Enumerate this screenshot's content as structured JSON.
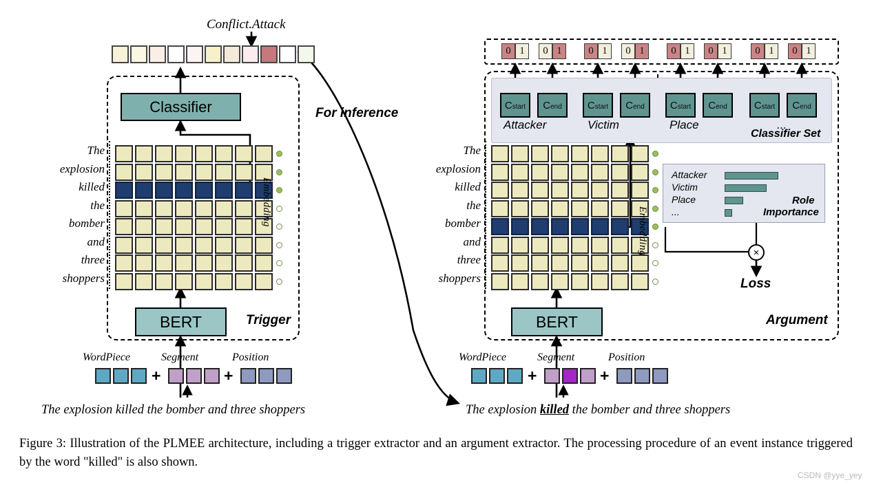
{
  "figure": {
    "caption": "Figure 3: Illustration of the PLMEE architecture, including a trigger extractor and an argument extractor. The processing procedure of an event instance triggered by the word \"killed\" is also shown.",
    "watermark": "CSDN @yye_yey"
  },
  "trigger_extractor": {
    "panel_label": "Trigger",
    "event_type_label": "Conflict.Attack",
    "classifier_label": "Classifier",
    "bert_label": "BERT",
    "embedding_label": "Embedding",
    "output_cells": [
      "#F7F2D8",
      "#FAF8E2",
      "#FAEFE7",
      "#FFFFFF",
      "#FBF4F3",
      "#F8F0C9",
      "#F4EADB",
      "#FBEAEE",
      "#C4797C",
      "#FFFFFF",
      "#F2F8EA"
    ],
    "highlighted_output_index": 8,
    "words": [
      "The",
      "explosion",
      "killed",
      "the",
      "bomber",
      "and",
      "three",
      "shoppers"
    ],
    "highlighted_word_index": 2,
    "grid_columns": 8,
    "embedding_inputs": {
      "wordpiece_label": "WordPiece",
      "segment_label": "Segment",
      "position_label": "Position",
      "wordpiece_count": 3,
      "segment_count": 3,
      "position_count": 3,
      "segment_highlight_index": -1,
      "plus_symbol": "+"
    },
    "sentence": "The explosion killed the bomber and three shoppers"
  },
  "inference_arrow_label": "For inference",
  "argument_extractor": {
    "panel_label": "Argument",
    "classifier_set_label": "Classifier Set",
    "bert_label": "BERT",
    "embedding_label": "Embedding",
    "roles": [
      {
        "name": "Attacker",
        "start_label": "C",
        "start_sub": "start",
        "end_label": "C",
        "end_sub": "end"
      },
      {
        "name": "Victim",
        "start_label": "C",
        "start_sub": "start",
        "end_label": "C",
        "end_sub": "end"
      },
      {
        "name": "Place",
        "start_label": "C",
        "start_sub": "start",
        "end_label": "C",
        "end_sub": "end"
      },
      {
        "name": "...",
        "start_label": "C",
        "start_sub": "start",
        "end_label": "C",
        "end_sub": "end"
      }
    ],
    "binary_outputs": [
      {
        "zero": "0",
        "one": "1",
        "zero_active": true,
        "one_active": false
      },
      {
        "zero": "0",
        "one": "1",
        "zero_active": false,
        "one_active": true
      },
      {
        "zero": "0",
        "one": "1",
        "zero_active": true,
        "one_active": false
      },
      {
        "zero": "0",
        "one": "1",
        "zero_active": false,
        "one_active": true
      },
      {
        "zero": "0",
        "one": "1",
        "zero_active": true,
        "one_active": false
      },
      {
        "zero": "0",
        "one": "1",
        "zero_active": true,
        "one_active": false
      },
      {
        "zero": "0",
        "one": "1",
        "zero_active": true,
        "one_active": false
      },
      {
        "zero": "0",
        "one": "1",
        "zero_active": true,
        "one_active": false
      }
    ],
    "words": [
      "The",
      "explosion",
      "killed",
      "the",
      "bomber",
      "and",
      "three",
      "shoppers"
    ],
    "highlighted_word_index": 4,
    "grid_columns": 8,
    "role_importance": {
      "title_line1": "Role",
      "title_line2": "Importance",
      "items": [
        {
          "label": "Attacker",
          "value": 100
        },
        {
          "label": "Victim",
          "value": 78
        },
        {
          "label": "Place",
          "value": 34
        },
        {
          "label": "...",
          "value": 14
        }
      ]
    },
    "multiply_symbol": "×",
    "loss_label": "Loss",
    "embedding_inputs": {
      "wordpiece_label": "WordPiece",
      "segment_label": "Segment",
      "position_label": "Position",
      "wordpiece_count": 3,
      "segment_count": 3,
      "position_count": 3,
      "segment_highlight_index": 1,
      "plus_symbol": "+"
    },
    "sentence_prefix": "The explosion ",
    "sentence_trigger": "killed",
    "sentence_suffix": " the bomber and three shoppers"
  }
}
